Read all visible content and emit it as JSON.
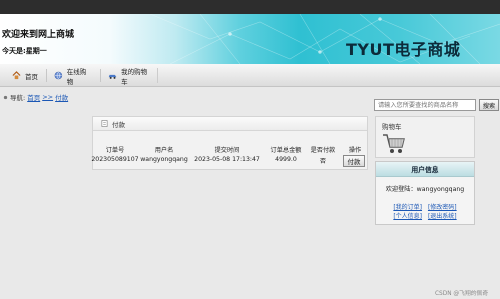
{
  "header": {
    "welcome": "欢迎来到网上商城",
    "today": "今天是:星期一",
    "brand": "TYUT电子商城"
  },
  "nav": {
    "home": "首页",
    "shop": "在线购物",
    "cart": "我的购物车"
  },
  "breadcrumb": {
    "prefix": "导航:",
    "home": "首页",
    "separator": ">>",
    "current": "付款"
  },
  "search": {
    "placeholder": "请输入您所要查找的商品名称",
    "button": "搜索"
  },
  "payment": {
    "title": "付款",
    "columns": [
      "订单号",
      "用户名",
      "提交时间",
      "订单总金额",
      "是否付款",
      "操作"
    ],
    "rows": [
      {
        "order_no": "202305089107",
        "username": "wangyongqang",
        "submit_time": "2023-05-08 17:13:47",
        "total": "4999.0",
        "paid": "否",
        "action": "付款"
      }
    ]
  },
  "cart_box": {
    "title": "购物车"
  },
  "user_box": {
    "title": "用户信息",
    "welcome": "欢迎登陆：wangyongqang",
    "links_row1": [
      "[我的订单]",
      "[修改密码]"
    ],
    "links_row2": [
      "[个人信息]",
      "[退出系统]"
    ]
  },
  "watermark": "CSDN @飞翔的佩奇",
  "icons": {
    "home": "home-icon",
    "shop": "globe-icon",
    "cart": "car-icon",
    "breadcrumb": "dot-icon",
    "payment_header": "document-icon",
    "cart_box": "shopping-cart-icon"
  }
}
